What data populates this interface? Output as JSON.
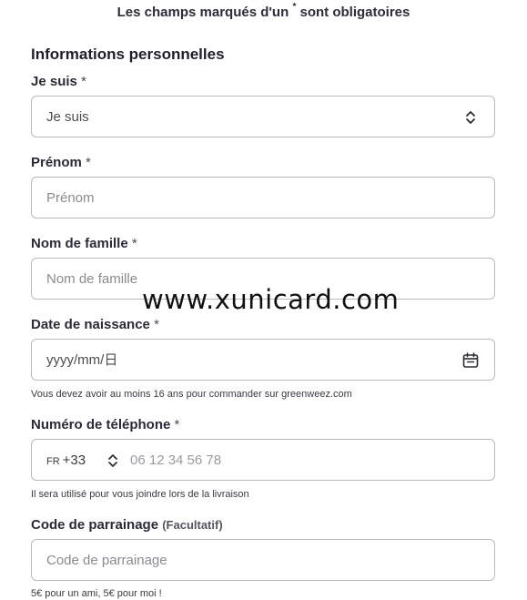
{
  "notice": {
    "before": "Les champs marqués d'un",
    "star": "*",
    "after": "sont obligatoires"
  },
  "section_title": "Informations personnelles",
  "fields": {
    "gender": {
      "label": "Je suis",
      "required": "*",
      "value": "Je suis",
      "icon": "select-updown-icon"
    },
    "firstname": {
      "label": "Prénom",
      "required": "*",
      "placeholder": "Prénom"
    },
    "lastname": {
      "label": "Nom de famille",
      "required": "*",
      "placeholder": "Nom de famille"
    },
    "birthdate": {
      "label": "Date de naissance",
      "required": "*",
      "placeholder": "yyyy/mm/日",
      "icon": "calendar-icon",
      "hint": "Vous devez avoir au moins 16 ans pour commander sur greenweez.com"
    },
    "phone": {
      "label": "Numéro de téléphone",
      "required": "*",
      "country": "FR",
      "dial_code": "+33",
      "placeholder": "06 12 34 56 78",
      "hint": "Il sera utilisé pour vous joindre lors de la livraison"
    },
    "referral": {
      "label": "Code de parrainage",
      "optional": "(Facultatif)",
      "placeholder": "Code de parrainage",
      "hint": "5€ pour un ami, 5€ pour moi !"
    }
  },
  "watermark": "www.xunicard.com"
}
